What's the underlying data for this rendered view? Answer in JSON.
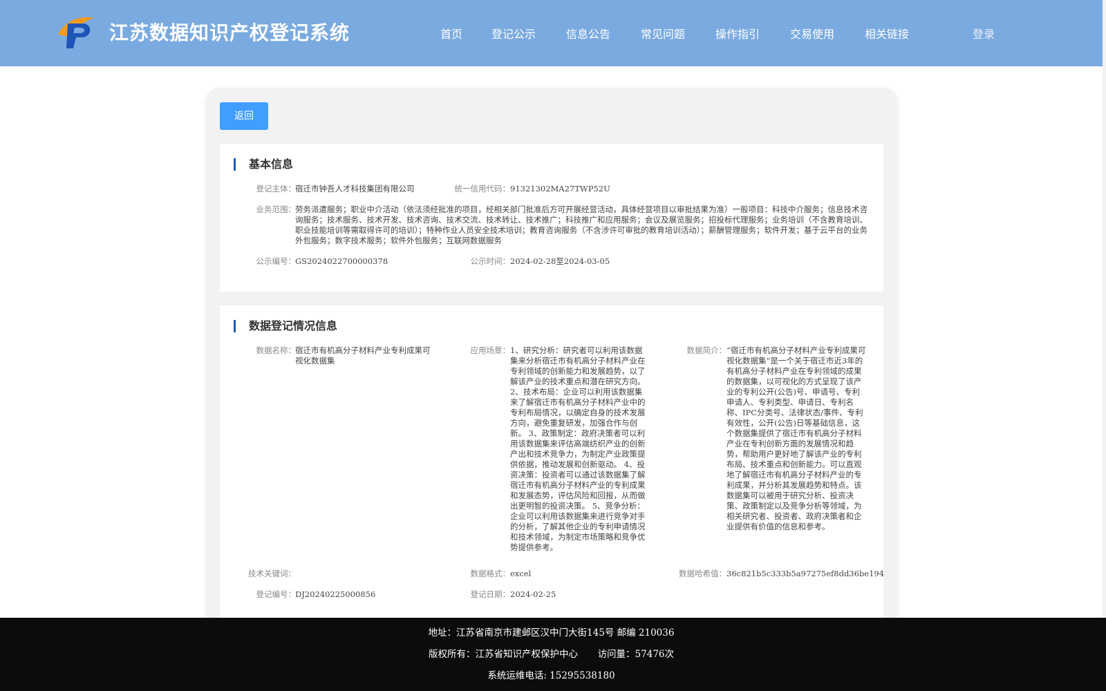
{
  "header": {
    "site_title": "江苏数据知识产权登记系统",
    "nav": [
      "首页",
      "登记公示",
      "信息公告",
      "常见问题",
      "操作指引",
      "交易使用",
      "相关链接"
    ],
    "login": "登录",
    "logo_icon": "jiangsu-ip-logo-icon",
    "colors": {
      "header_bg": "#7aaadf",
      "accent": "#409eff",
      "section_bar": "#1a5fb4"
    }
  },
  "back_button": "返回",
  "basic_info": {
    "title": "基本信息",
    "subject_label": "登记主体：",
    "subject_value": "宿迁市钟吾人才科技集团有限公司",
    "credit_label": "统一信用代码：",
    "credit_value": "91321302MA27TWP52U",
    "scope_label": "业务范围：",
    "scope_value": "劳务派遣服务；职业中介活动（依法须经批准的项目，经相关部门批准后方可开展经营活动，具体经营项目以审批结果为准）一般项目：科技中介服务；信息技术咨询服务；技术服务、技术开发、技术咨询、技术交流、技术转让、技术推广；科技推广和应用服务；会议及展览服务；招投标代理服务；业务培训（不含教育培训、职业技能培训等需取得许可的培训）；特种作业人员安全技术培训；教育咨询服务（不含涉许可审批的教育培训活动）；薪酬管理服务；软件开发；基于云平台的业务外包服务；数字技术服务；软件外包服务；互联网数据服务",
    "pub_no_label": "公示编号：",
    "pub_no_value": "GS2024022700000378",
    "pub_time_label": "公示时间：",
    "pub_time_value": "2024-02-28至2024-03-05"
  },
  "data_info": {
    "title": "数据登记情况信息",
    "name_label": "数据名称：",
    "name_value": "宿迁市有机高分子材料产业专利成果可视化数据集",
    "scene_label": "应用场景：",
    "scene_value": "1、研究分析：研究者可以利用该数据集来分析宿迁市有机高分子材料产业在专利领域的创新能力和发展趋势，以了解该产业的技术重点和潜在研究方向。 2、技术布局：企业可以利用该数据集来了解宿迁市有机高分子材料产业中的专利布局情况，以确定自身的技术发展方向，避免重复研发，加强合作与创新。 3、政策制定：政府决策者可以利用该数据集来评估高端纺织产业的创新产出和技术竞争力，为制定产业政策提供依据，推动发展和创新驱动。 4、投资决策：投资者可以通过该数据集了解宿迁市有机高分子材料产业的专利成果和发展态势，评估风险和回报，从而做出更明智的投资决策。 5、竞争分析：企业可以利用该数据集来进行竞争对手的分析，了解其他企业的专利申请情况和技术领域，为制定市场策略和竞争优势提供参考。",
    "intro_label": "数据简介：",
    "intro_value": "“宿迁市有机高分子材料产业专利成果可视化数据集”是一个关于宿迁市近3年的有机高分子材料产业在专利领域的成果的数据集，以可视化的方式呈现了该产业的专利公开(公告)号、申请号、专利申请人、专利类型、申请日、专利名称、IPC分类号、法律状态/事件、专利有效性，公开(公告)日等基础信息，这个数据集提供了宿迁市有机高分子材料产业在专利创新方面的发展情况和趋势，帮助用户更好地了解该产业的专利布局、技术重点和创新能力。可以直观地了解宿迁市有机高分子材料产业的专利成果，并分析其发展趋势和特点。该数据集可以被用于研究分析、投资决策、政策制定以及竞争分析等领域，为相关研究者、投资者、政府决策者和企业提供有价值的信息和参考。",
    "keywords_label": "技术关键词：",
    "keywords_value": "",
    "format_label": "数据格式：",
    "format_value": "excel",
    "hash_label": "数据哈希值：",
    "hash_value": "36c821b5c333b5a97275ef8dd36be194",
    "reg_no_label": "登记编号：",
    "reg_no_value": "DJ20240225000856",
    "reg_date_label": "登记日期：",
    "reg_date_value": "2024-02-25"
  },
  "footer": {
    "address": "地址：江苏省南京市建邺区汉中门大街145号 邮编 210036",
    "copyright": "版权所有：江苏省知识产权保护中心",
    "visits": "访问量：57476次",
    "phone": "系统运维电话: 15295538180"
  }
}
